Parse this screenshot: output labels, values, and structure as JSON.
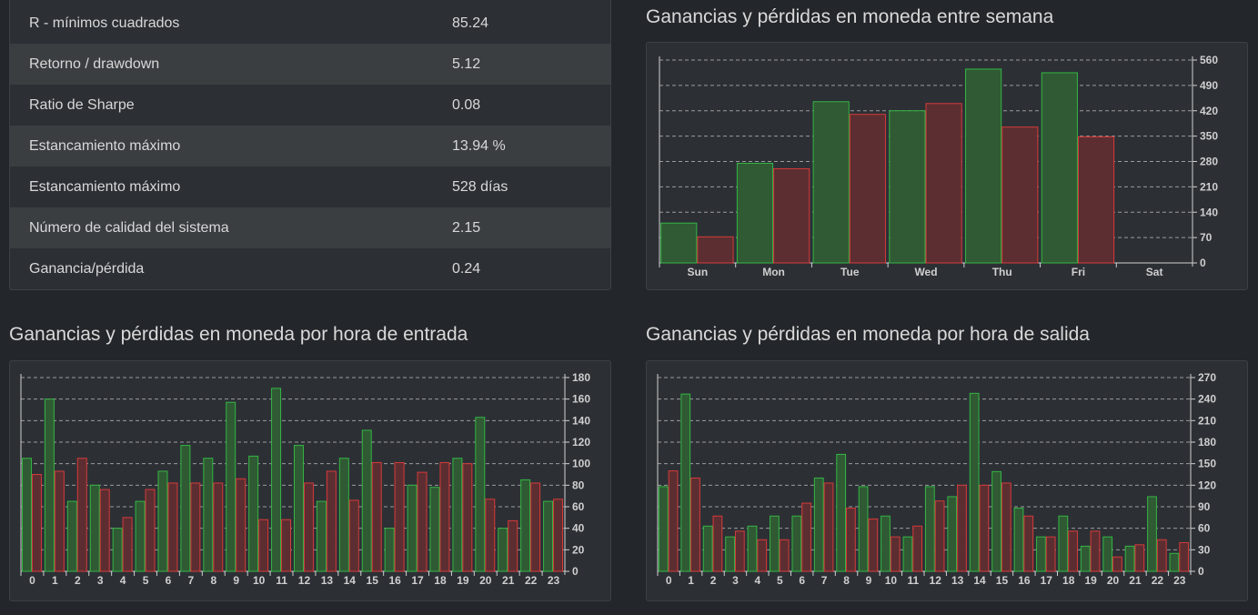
{
  "stats": {
    "rows": [
      {
        "label": "R - mínimos cuadrados",
        "value": "85.24"
      },
      {
        "label": "Retorno / drawdown",
        "value": "5.12"
      },
      {
        "label": "Ratio de Sharpe",
        "value": "0.08"
      },
      {
        "label": "Estancamiento máximo",
        "value": "13.94 %"
      },
      {
        "label": "Estancamiento máximo",
        "value": "528 días"
      },
      {
        "label": "Número de calidad del sistema",
        "value": "2.15"
      },
      {
        "label": "Ganancia/pérdida",
        "value": "0.24"
      }
    ]
  },
  "colors": {
    "gain_fill": "#2f5a33",
    "gain_stroke": "#35b545",
    "loss_fill": "#5c2e31",
    "loss_stroke": "#d63a3a",
    "background": "#23262a",
    "panel": "#2c3035",
    "grid": "#9a9a9a"
  },
  "charts": {
    "weekday": {
      "title": "Ganancias y pérdidas en moneda entre semana"
    },
    "entry": {
      "title": "Ganancias y pérdidas en moneda por hora de entrada"
    },
    "exit": {
      "title": "Ganancias y pérdidas en moneda por hora de salida"
    }
  },
  "chart_data": [
    {
      "id": "weekday",
      "type": "bar",
      "title": "Ganancias y pérdidas en moneda entre semana",
      "categories": [
        "Sun",
        "Mon",
        "Tue",
        "Wed",
        "Thu",
        "Fri",
        "Sat"
      ],
      "series": [
        {
          "color": "#35b545",
          "values": [
            110,
            275,
            445,
            420,
            535,
            525,
            0
          ]
        },
        {
          "color": "#d63a3a",
          "values": [
            72,
            260,
            410,
            440,
            375,
            348,
            0
          ]
        }
      ],
      "ylim": [
        0,
        560
      ],
      "yticks": [
        0,
        70,
        140,
        210,
        280,
        350,
        420,
        490,
        560
      ],
      "grid": true,
      "axis_side": "right"
    },
    {
      "id": "entry",
      "type": "bar",
      "title": "Ganancias y pérdidas en moneda por hora de entrada",
      "categories": [
        "0",
        "1",
        "2",
        "3",
        "4",
        "5",
        "6",
        "7",
        "8",
        "9",
        "10",
        "11",
        "12",
        "13",
        "14",
        "15",
        "16",
        "17",
        "18",
        "19",
        "20",
        "21",
        "22",
        "23"
      ],
      "series": [
        {
          "color": "#35b545",
          "values": [
            105,
            160,
            65,
            80,
            40,
            65,
            93,
            117,
            105,
            157,
            107,
            170,
            117,
            65,
            105,
            131,
            40,
            80,
            78,
            105,
            143,
            40,
            85,
            65
          ]
        },
        {
          "color": "#d63a3a",
          "values": [
            90,
            93,
            105,
            76,
            50,
            76,
            82,
            82,
            82,
            86,
            48,
            48,
            82,
            93,
            66,
            101,
            101,
            92,
            101,
            100,
            67,
            47,
            82,
            67
          ]
        }
      ],
      "ylim": [
        0,
        180
      ],
      "yticks": [
        0,
        20,
        40,
        60,
        80,
        100,
        120,
        140,
        160,
        180
      ],
      "grid": true,
      "axis_side": "right"
    },
    {
      "id": "exit",
      "type": "bar",
      "title": "Ganancias y pérdidas en moneda por hora de salida",
      "categories": [
        "0",
        "1",
        "2",
        "3",
        "4",
        "5",
        "6",
        "7",
        "8",
        "9",
        "10",
        "11",
        "12",
        "13",
        "14",
        "15",
        "16",
        "17",
        "18",
        "19",
        "20",
        "21",
        "22",
        "23"
      ],
      "series": [
        {
          "color": "#35b545",
          "values": [
            118,
            247,
            63,
            48,
            63,
            77,
            77,
            130,
            163,
            118,
            77,
            48,
            118,
            104,
            248,
            139,
            88,
            48,
            77,
            35,
            48,
            35,
            104,
            25
          ]
        },
        {
          "color": "#d63a3a",
          "values": [
            140,
            130,
            77,
            56,
            44,
            44,
            95,
            123,
            88,
            73,
            48,
            63,
            98,
            120,
            120,
            123,
            77,
            48,
            56,
            56,
            20,
            37,
            44,
            40
          ]
        }
      ],
      "ylim": [
        0,
        270
      ],
      "yticks": [
        0,
        30,
        60,
        90,
        120,
        150,
        180,
        210,
        240,
        270
      ],
      "grid": true,
      "axis_side": "right"
    }
  ]
}
